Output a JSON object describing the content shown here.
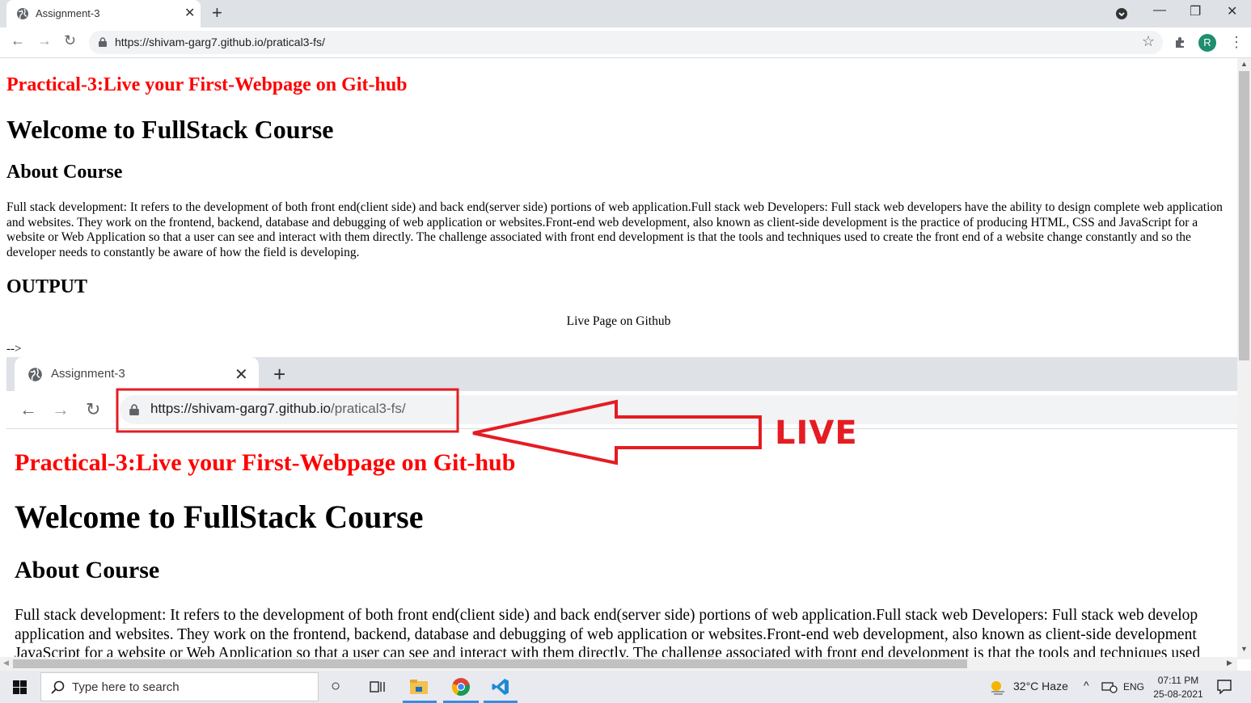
{
  "browser": {
    "tab_title": "Assignment-3",
    "url": "https://shivam-garg7.github.io/pratical3-fs/",
    "profile_initial": "R"
  },
  "page": {
    "practical_heading": "Practical-3:Live your First-Webpage on Git-hub",
    "welcome_heading": "Welcome to FullStack Course",
    "about_heading": "About Course",
    "about_text": "Full stack development: It refers to the development of both front end(client side) and back end(server side) portions of web application.Full stack web Developers: Full stack web developers have the ability to design complete web application and websites. They work on the frontend, backend, database and debugging of web application or websites.Front-end web development, also known as client-side development is the practice of producing HTML, CSS and JavaScript for a website or Web Application so that a user can see and interact with them directly. The challenge associated with front end development is that the tools and techniques used to create the front end of a website change constantly and so the developer needs to constantly be aware of how the field is developing.",
    "output_heading": "OUTPUT",
    "live_caption": "Live Page on Github",
    "stray_comment": "-->"
  },
  "screenshot": {
    "tab_title": "Assignment-3",
    "url_host": "https://shivam-garg7.github.io",
    "url_path": "/pratical3-fs/",
    "practical_heading": "Practical-3:Live your First-Webpage on Git-hub",
    "welcome_heading": "Welcome to FullStack Course",
    "about_heading": "About Course",
    "para_line1": "Full stack development: It refers to the development of both front end(client side) and back end(server side) portions of web application.Full stack web Developers: Full stack web develop",
    "para_line2": "application and websites. They work on the frontend, backend, database and debugging of web application or websites.Front-end web development, also known as client-side development",
    "para_line3": "JavaScript for a website or Web Application so that a user can see and interact with them directly. The challenge associated with front end development is that the tools and techniques used",
    "annotation_label": "LIVE",
    "annotation_color": "#e51c23"
  },
  "taskbar": {
    "search_placeholder": "Type here to search",
    "weather": "32°C  Haze",
    "language": "ENG",
    "time": "07:11 PM",
    "date": "25-08-2021"
  }
}
